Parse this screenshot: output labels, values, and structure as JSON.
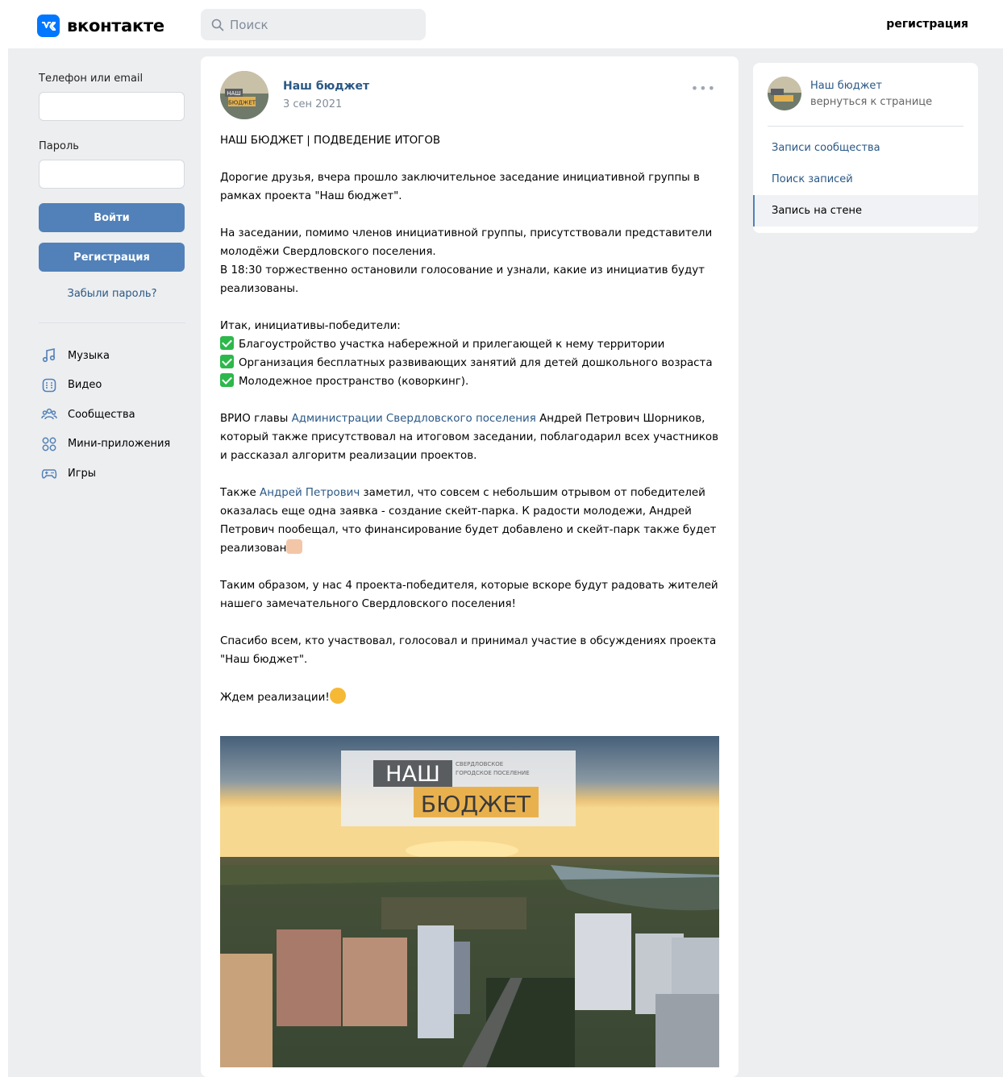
{
  "header": {
    "logo_letters": "VK",
    "logo_text": "вконтакте",
    "search_placeholder": "Поиск",
    "register_link": "регистрация"
  },
  "login": {
    "phone_label": "Телефон или email",
    "password_label": "Пароль",
    "login_button": "Войти",
    "register_button": "Регистрация",
    "forgot_link": "Забыли пароль?"
  },
  "nav": {
    "items": [
      {
        "label": "Музыка",
        "icon": "music-icon"
      },
      {
        "label": "Видео",
        "icon": "video-icon"
      },
      {
        "label": "Сообщества",
        "icon": "communities-icon"
      },
      {
        "label": "Мини-приложения",
        "icon": "mini-apps-icon"
      },
      {
        "label": "Игры",
        "icon": "games-icon"
      }
    ]
  },
  "post": {
    "author": "Наш бюджет",
    "date": "3 сен 2021",
    "more": "•••",
    "title": "НАШ БЮДЖЕТ | ПОДВЕДЕНИЕ ИТОГОВ",
    "p1": "Дорогие друзья, вчера прошло заключительное заседание инициативной группы в рамках проекта \"Наш бюджет\".",
    "p2_line1": "На заседании, помимо членов инициативной группы, присутствовали представители молодёжи Свердловского поселения.",
    "p2_line2": "В 18:30 торжественно остановили голосование и узнали, какие из инициатив будут реализованы.",
    "p3_intro": "Итак, инициативы-победители:",
    "winners": [
      "Благоустройство участка набережной и прилегающей к нему территории",
      "Организация бесплатных развивающих занятий для детей дошкольного возраста",
      "Молодежное пространство (коворкинг)."
    ],
    "p4_before": "ВРИО главы ",
    "p4_link": "Администрации Свердловского поселения",
    "p4_after": " Андрей Петрович Шорников, который также присутствовал на итоговом заседании, поблагодарил всех участников и рассказал алгоритм реализации проектов.",
    "p5_before": "Также ",
    "p5_link": "Андрей Петрович",
    "p5_after": " заметил, что совсем с небольшим отрывом от победителей оказалась еще одна заявка - создание скейт-парка. К радости молодежи, Андрей Петрович пообещал, что финансирование будет добавлено и скейт-парк также будет реализован",
    "p6": "Таким образом, у нас 4 проекта-победителя, которые вскоре будут радовать жителей нашего замечательного Свердловского поселения!",
    "p7": "Спасибо всем, кто участвовал, голосовал и принимал участие в обсуждениях проекта \"Наш бюджет\".",
    "p8": "Ждем реализации!",
    "image": {
      "logo_top": "НАШ",
      "logo_bottom": "БЮДЖЕТ",
      "logo_sub1": "СВЕРДЛОВСКОЕ",
      "logo_sub2": "ГОРОДСКОЕ ПОСЕЛЕНИЕ"
    }
  },
  "sidebar": {
    "group_name": "Наш бюджет",
    "back_link": "вернуться к странице",
    "items": [
      {
        "label": "Записи сообщества"
      },
      {
        "label": "Поиск записей"
      },
      {
        "label": "Запись на стене",
        "active": true
      }
    ]
  },
  "colors": {
    "accent": "#5181b8",
    "link": "#2a5885",
    "background": "#edeef0"
  }
}
